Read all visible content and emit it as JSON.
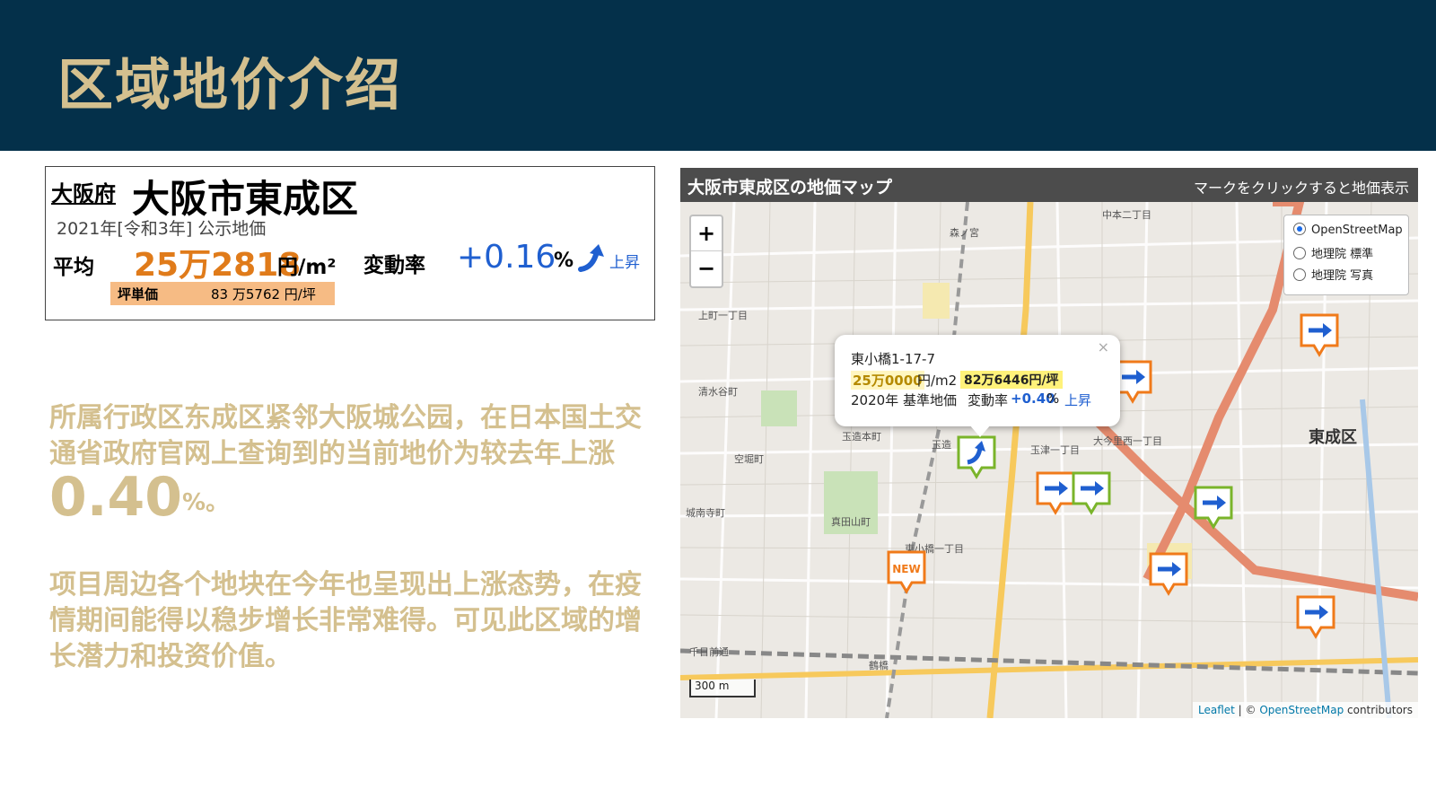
{
  "slide": {
    "title": "区域地价介绍"
  },
  "card": {
    "prefecture": "大阪府",
    "city": "大阪市東成区",
    "year_note": "2021年[令和3年] 公示地価",
    "avg_label": "平均",
    "avg_price": "25万2818",
    "avg_unit": "円/m²",
    "rate_label": "変動率",
    "rate_value": "+0.16",
    "rate_unit": "%",
    "rise_label": "上昇",
    "tsubo_label": "坪単価",
    "tsubo_value": "83 万5762 円/坪",
    "accent_color": "#e07b1a",
    "rate_color": "#1f5fd0"
  },
  "body": {
    "para1_text": "所属行政区东成区紧邻大阪城公园，在日本国土交通省政府官网上查询到的当前地价为较去年上涨",
    "para1_number": "0.40",
    "para1_suffix": "%。",
    "para2_text": "项目周边各个地块在今年也呈现出上涨态势，在疫情期间能得以稳步增长非常难得。可见此区域的增长潜力和投资价值。"
  },
  "map": {
    "title": "大阪市東成区の地価マップ",
    "hint": "マークをクリックすると地価表示",
    "zoom_in": "+",
    "zoom_out": "−",
    "layers": [
      "OpenStreetMap",
      "地理院 標準",
      "地理院 写真"
    ],
    "selected_layer": "OpenStreetMap",
    "popup": {
      "address": "東小橋1-17-7",
      "price": "25万0000",
      "price_unit": "円/m2",
      "tsubo": "82万6446円/坪",
      "type": "2020年 基準地価",
      "rate_label": "変動率",
      "rate": "+0.40",
      "rate_unit": "%",
      "rise": "上昇",
      "close": "×"
    },
    "new_badge": "NEW",
    "scale": "300 m",
    "attribution_leaflet": "Leaflet",
    "attribution_osm": "OpenStreetMap",
    "attribution_suffix": "contributors",
    "place_labels": {
      "ward": "東成区",
      "tamatsukuri": "玉造",
      "morinomiya": "森ノ宮",
      "tsuruhashi": "鶴橋",
      "higashiobase": "東小橋一丁目",
      "oimazato": "大今里西一丁目",
      "nakamoto": "中本二丁目",
      "tamatsu": "玉津一丁目",
      "sanada": "真田山町",
      "jonan": "城南寺町",
      "karahori": "空堀町",
      "shimizudani": "清水谷町",
      "kamimachi": "上町一丁目",
      "tamatsukuri_hon": "玉造本町",
      "sennichimae": "千日前通"
    },
    "marker_colors": {
      "orange": "#f07a1a",
      "green": "#7ab42a",
      "arrow": "#1f5fd0"
    }
  }
}
